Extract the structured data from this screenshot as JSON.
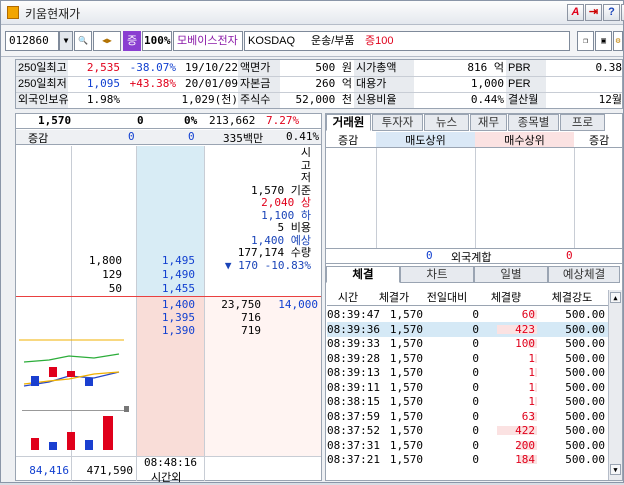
{
  "window": {
    "title": "키움현재가",
    "buttons": [
      "A",
      "?",
      "×"
    ]
  },
  "toolbar": {
    "code": "012860",
    "ratio": "100%",
    "badge": "증",
    "name": "모베이스전자",
    "market": "KOSDAQ",
    "sector": "운송/부품",
    "margin": "증100"
  },
  "info": {
    "row1": {
      "l1": "250일최고",
      "v1": "2,535",
      "p1": "-38.07%",
      "d1": "19/10/22",
      "l2": "액면가",
      "v2": "500 원",
      "l3": "시가총액",
      "v3": "816 억",
      "l4": "PBR",
      "v4": "0.38"
    },
    "row2": {
      "l1": "250일최저",
      "v1": "1,095",
      "p1": "+43.38%",
      "d1": "20/01/09",
      "l2": "자본금",
      "v2": "260 억",
      "l3": "대용가",
      "v3": "1,000",
      "l4": "PER",
      "v4": ""
    },
    "row3": {
      "l1": "외국인보유",
      "v1": "1.98%",
      "p1": "",
      "d1": "1,029(천)",
      "l2": "주식수",
      "v2": "52,000 천",
      "l3": "신용비율",
      "v3": "0.44%",
      "l4": "결산월",
      "v4": "12월"
    }
  },
  "orderbook": {
    "price": "1,570",
    "change": "0",
    "pct": "0%",
    "volume": "213,662",
    "vol_ratio": "7.27%",
    "label_change": "증감",
    "sell_total": "0",
    "buy_total": "0",
    "amount": "335백만",
    "amount_pct": "0.41%",
    "info_lines": [
      "시",
      "고",
      "저",
      "1,570 기준",
      "2,040 상",
      "1,100 하",
      "5 비용",
      "1,400 예상",
      "177,174 수량",
      "▼ 170  -10.83%"
    ],
    "asks": [
      {
        "qty": "1,800",
        "price": "1,495"
      },
      {
        "qty": "129",
        "price": "1,490"
      },
      {
        "qty": "50",
        "price": "1,455"
      }
    ],
    "bids": [
      {
        "price": "1,400",
        "qty": "23,750",
        "extra": "14,000"
      },
      {
        "price": "1,395",
        "qty": "716",
        "extra": ""
      },
      {
        "price": "1,390",
        "qty": "719",
        "extra": ""
      }
    ],
    "footer_sell": "84,416",
    "footer_buy": "471,590",
    "time": "08:48:16",
    "time_label": "시간외"
  },
  "broker": {
    "tabs": [
      "거래원",
      "투자자",
      "뉴스",
      "재무",
      "종목별",
      "프로"
    ],
    "col_change": "증감",
    "col_sell": "매도상위",
    "col_buy": "매수상위",
    "col_change2": "증감",
    "foreign_label": "외국계합",
    "foreign_sell": "0",
    "foreign_buy": "0"
  },
  "trades": {
    "tabs": [
      "체결",
      "차트",
      "일별",
      "예상체결"
    ],
    "headers": [
      "시간",
      "체결가",
      "전일대비",
      "체결량",
      "체결강도"
    ],
    "rows": [
      {
        "time": "08:39:47",
        "price": "1,570",
        "diff": "0",
        "qty": "60",
        "str": "500.00"
      },
      {
        "time": "08:39:36",
        "price": "1,570",
        "diff": "0",
        "qty": "423",
        "str": "500.00"
      },
      {
        "time": "08:39:33",
        "price": "1,570",
        "diff": "0",
        "qty": "100",
        "str": "500.00"
      },
      {
        "time": "08:39:28",
        "price": "1,570",
        "diff": "0",
        "qty": "1",
        "str": "500.00"
      },
      {
        "time": "08:39:13",
        "price": "1,570",
        "diff": "0",
        "qty": "1",
        "str": "500.00"
      },
      {
        "time": "08:39:11",
        "price": "1,570",
        "diff": "0",
        "qty": "1",
        "str": "500.00"
      },
      {
        "time": "08:38:15",
        "price": "1,570",
        "diff": "0",
        "qty": "1",
        "str": "500.00"
      },
      {
        "time": "08:37:59",
        "price": "1,570",
        "diff": "0",
        "qty": "63",
        "str": "500.00"
      },
      {
        "time": "08:37:52",
        "price": "1,570",
        "diff": "0",
        "qty": "422",
        "str": "500.00"
      },
      {
        "time": "08:37:31",
        "price": "1,570",
        "diff": "0",
        "qty": "200",
        "str": "500.00"
      },
      {
        "time": "08:37:21",
        "price": "1,570",
        "diff": "0",
        "qty": "184",
        "str": "500.00"
      }
    ]
  }
}
